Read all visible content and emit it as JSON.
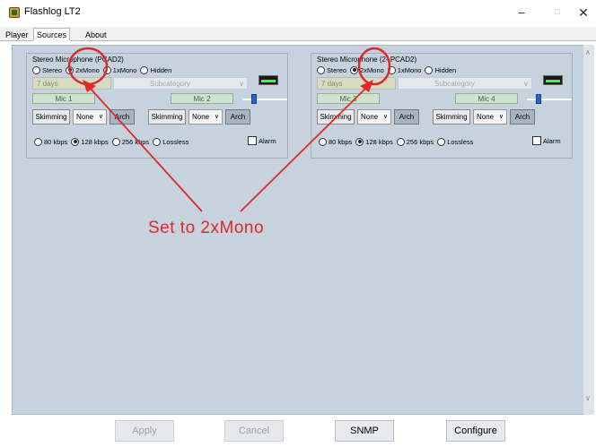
{
  "window": {
    "title": "Flashlog LT2",
    "minimize": "–",
    "maximize": "□",
    "close": "✕"
  },
  "tabs": [
    {
      "label": "Player",
      "active": false
    },
    {
      "label": "Sources",
      "active": true
    },
    {
      "label": "About",
      "active": false
    }
  ],
  "sources": [
    {
      "title": "Stereo Microphone (PCAD2)",
      "modes": [
        "Stereo",
        "2xMono",
        "1xMono",
        "Hidden"
      ],
      "selected_mode": "2xMono",
      "days": "7 days",
      "subcategory_placeholder": "Subcategory",
      "mic_a": "Mic 1",
      "mic_b": "Mic 2",
      "slider_level": 0.25,
      "skimming_label": "Skimming",
      "select_value": "None",
      "arch_label": "Arch",
      "rates": [
        "80 kbps",
        "128 kbps",
        "256 kbps",
        "Lossless"
      ],
      "selected_rate": "128 kbps",
      "alarm_label": "Alarm"
    },
    {
      "title": "Stereo Microphone (2- PCAD2)",
      "modes": [
        "Stereo",
        "2xMono",
        "1xMono",
        "Hidden"
      ],
      "selected_mode": "2xMono",
      "days": "7 days",
      "subcategory_placeholder": "Subcategory",
      "mic_a": "Mic 3",
      "mic_b": "Mic 4",
      "slider_level": 0.25,
      "skimming_label": "Skimming",
      "select_value": "None",
      "arch_label": "Arch",
      "rates": [
        "80 kbps",
        "128 kbps",
        "256 kbps",
        "Lossless"
      ],
      "selected_rate": "128 kbps",
      "alarm_label": "Alarm"
    }
  ],
  "annotation": {
    "text": "Set to 2xMono",
    "color": "#e02828"
  },
  "footer": {
    "apply": "Apply",
    "cancel": "Cancel",
    "snmp": "SNMP",
    "configure": "Configure"
  },
  "colors": {
    "panel": "#c6d3de",
    "accent": "#e02828",
    "meter_green": "#3cff3c",
    "slider_blue": "#2a62c8"
  }
}
